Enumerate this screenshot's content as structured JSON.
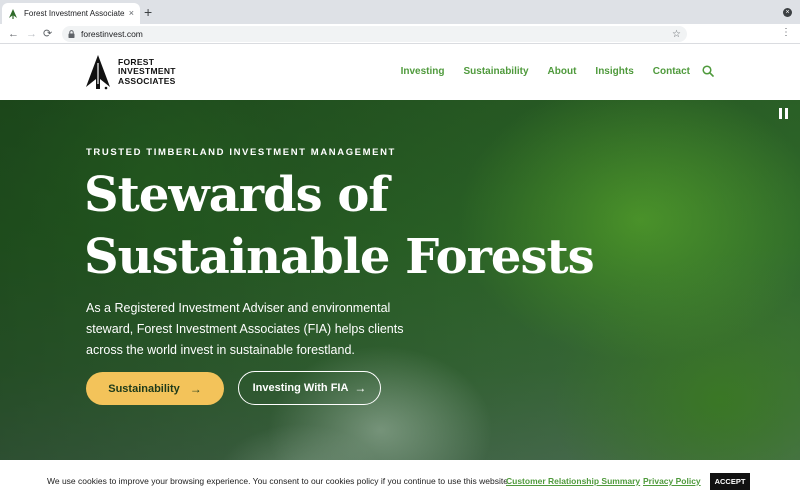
{
  "browser": {
    "tab_title": "Forest Investment Associates",
    "tab_close": "×",
    "new_tab": "+",
    "url": "forestinvest.com",
    "back": "←",
    "forward": "→",
    "reload": "⟳",
    "bookmark": "☆",
    "menu": "⋮",
    "profile_glyph": "×"
  },
  "header": {
    "logo_line1": "FOREST",
    "logo_line2": "INVESTMENT",
    "logo_line3": "ASSOCIATES",
    "nav": [
      "Investing",
      "Sustainability",
      "About",
      "Insights",
      "Contact"
    ],
    "icons": [
      "logo-tree-icon",
      "search-icon"
    ]
  },
  "hero": {
    "eyebrow": "TRUSTED TIMBERLAND INVESTMENT MANAGEMENT",
    "headline_line1": "Stewards of",
    "headline_line2": "Sustainable Forests",
    "intro": "As a Registered Investment Adviser and environmental steward, Forest Investment Associates (FIA) helps clients across the world invest in sustainable forestland.",
    "primary_button": "Sustainability",
    "secondary_button": "Investing With FIA",
    "arrow": "→"
  },
  "cookie": {
    "text": "We use cookies to improve your browsing experience. You consent to our cookies policy if you continue to use this website.",
    "link1": "Customer Relationship Summary",
    "link2": "Privacy Policy",
    "accept": "ACCEPT"
  },
  "colors": {
    "brand_green": "#4f9a3c",
    "button_gold": "#f3c35a",
    "hero_green": "#2f6a2a"
  }
}
